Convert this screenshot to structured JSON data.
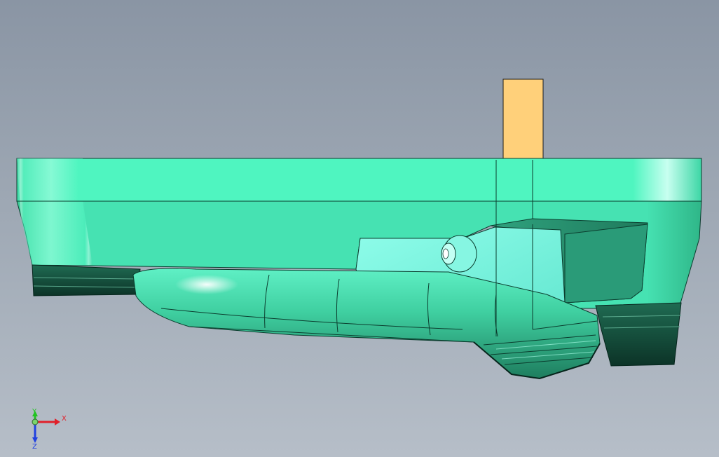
{
  "viewport": {
    "background_top": "#8a95a4",
    "background_bottom": "#b6bec8"
  },
  "model": {
    "part_name": "",
    "colors": {
      "main_body": "#4de8b8",
      "light_face": "#6ff5cf",
      "cyan_face": "#7ff8e6",
      "dark_edge": "#0b3d2e",
      "shadow_face": "#2f9e7c",
      "tab": "#ffd07a"
    }
  },
  "triad": {
    "x_label": "X",
    "y_label": "Y",
    "z_label": "Z",
    "x_color": "#e0202a",
    "y_color": "#22c422",
    "z_color": "#2040e0"
  }
}
